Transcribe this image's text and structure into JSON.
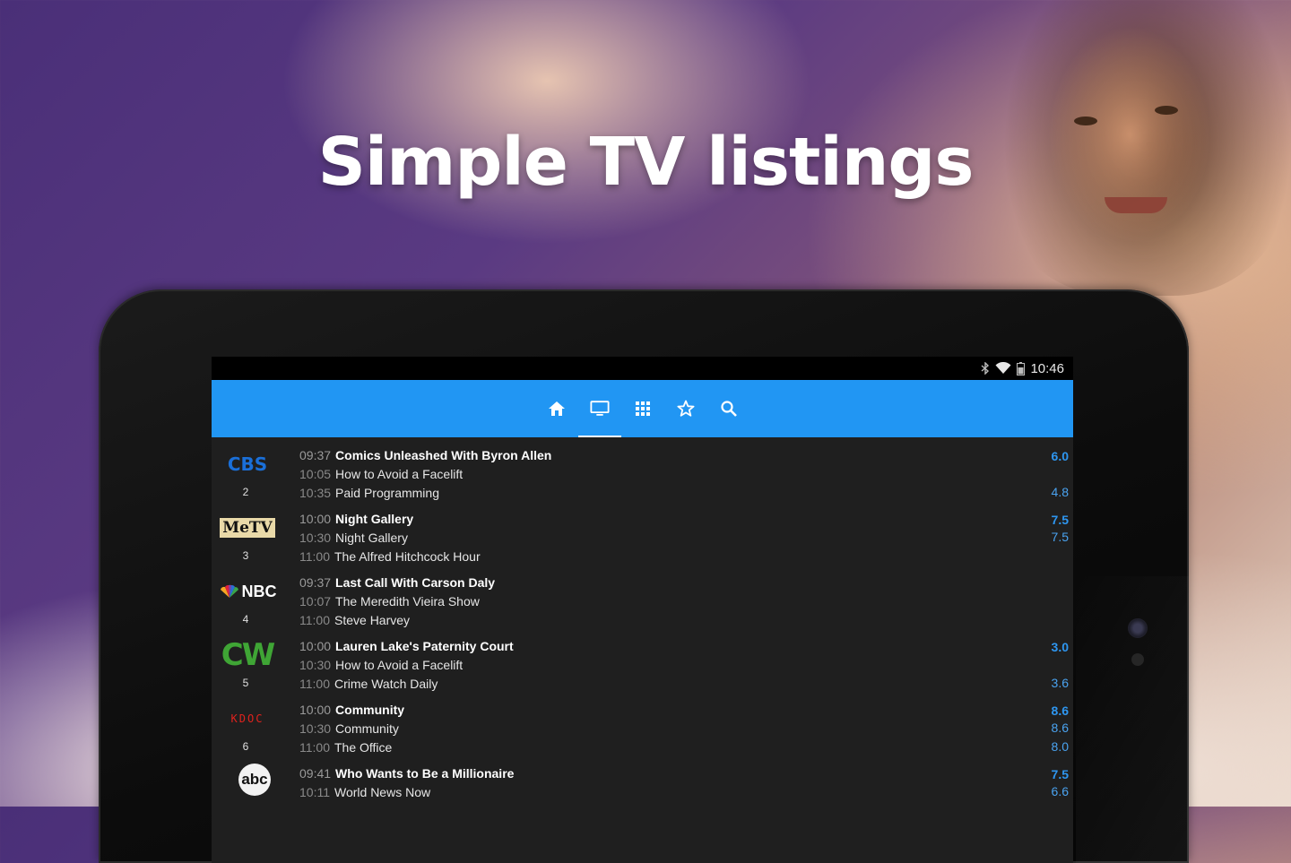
{
  "headline": "Simple TV listings",
  "status_bar": {
    "time": "10:46",
    "icons": [
      "bluetooth-icon",
      "wifi-icon",
      "battery-icon"
    ]
  },
  "toolbar": {
    "icons": [
      "home-icon",
      "tv-icon",
      "grid-icon",
      "star-icon",
      "search-icon"
    ],
    "active": "tv-icon",
    "accent_color": "#2196f3"
  },
  "channels": [
    {
      "logo": "CBS",
      "number": "2",
      "programs": [
        {
          "time": "09:37",
          "title": "Comics Unleashed With Byron Allen"
        },
        {
          "time": "10:05",
          "title": "How to Avoid a Facelift"
        },
        {
          "time": "10:35",
          "title": "Paid Programming"
        }
      ],
      "ratings": [
        "6.0",
        "",
        "4.8"
      ]
    },
    {
      "logo": "MeTV",
      "number": "3",
      "programs": [
        {
          "time": "10:00",
          "title": "Night Gallery"
        },
        {
          "time": "10:30",
          "title": "Night Gallery"
        },
        {
          "time": "11:00",
          "title": "The Alfred Hitchcock Hour"
        }
      ],
      "ratings": [
        "7.5",
        "7.5",
        ""
      ]
    },
    {
      "logo": "NBC",
      "number": "4",
      "programs": [
        {
          "time": "09:37",
          "title": "Last Call With Carson Daly"
        },
        {
          "time": "10:07",
          "title": "The Meredith Vieira Show"
        },
        {
          "time": "11:00",
          "title": "Steve Harvey"
        }
      ],
      "ratings": [
        "",
        "",
        ""
      ]
    },
    {
      "logo": "CW",
      "number": "5",
      "programs": [
        {
          "time": "10:00",
          "title": "Lauren Lake's Paternity Court"
        },
        {
          "time": "10:30",
          "title": "How to Avoid a Facelift"
        },
        {
          "time": "11:00",
          "title": "Crime Watch Daily"
        }
      ],
      "ratings": [
        "3.0",
        "",
        "3.6"
      ]
    },
    {
      "logo": "KDOC",
      "number": "6",
      "programs": [
        {
          "time": "10:00",
          "title": "Community"
        },
        {
          "time": "10:30",
          "title": "Community"
        },
        {
          "time": "11:00",
          "title": "The Office"
        }
      ],
      "ratings": [
        "8.6",
        "8.6",
        "8.0"
      ]
    },
    {
      "logo": "abc",
      "number": "",
      "programs": [
        {
          "time": "09:41",
          "title": "Who Wants to Be a Millionaire"
        },
        {
          "time": "10:11",
          "title": "World News Now"
        },
        {
          "time": "",
          "title": ""
        }
      ],
      "ratings": [
        "7.5",
        "6.6",
        ""
      ]
    }
  ]
}
